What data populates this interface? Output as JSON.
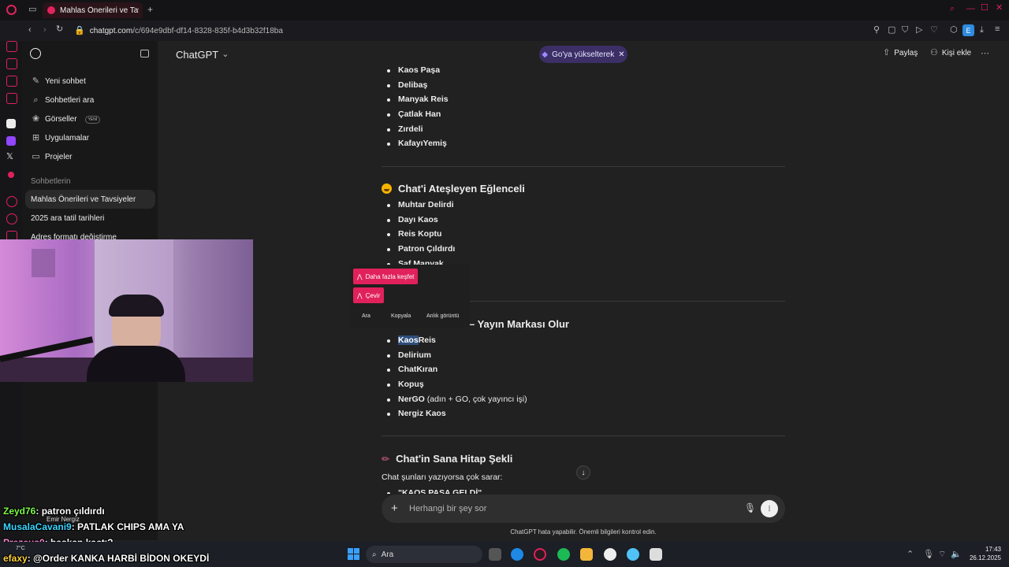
{
  "browser": {
    "tab_title": "Mahlas Önerileri ve Tavsiy",
    "url_host": "chatgpt.com",
    "url_path": "/c/694e9dbf-df14-8328-835f-b4d3b32f18ba",
    "ext_badge": "E"
  },
  "sidebar": {
    "items": [
      {
        "label": "Yeni sohbet",
        "icon": "edit-icon"
      },
      {
        "label": "Sohbetleri ara",
        "icon": "search-icon"
      },
      {
        "label": "Görseller",
        "icon": "image-icon",
        "badge": "YENİ"
      },
      {
        "label": "Uygulamalar",
        "icon": "apps-icon"
      },
      {
        "label": "Projeler",
        "icon": "folder-icon"
      }
    ],
    "section": "Sohbetlerin",
    "chats": [
      "Mahlas Önerileri ve Tavsiyeler",
      "2025 ara tatil tarihleri",
      "Adres formatı değiştirme"
    ]
  },
  "topbar": {
    "model": "ChatGPT",
    "upgrade": "Go'ya yükselterek",
    "share": "Paylaş",
    "add_person": "Kişi ekle"
  },
  "content": {
    "list1": [
      "Kaos Paşa",
      "Delibaş",
      "Manyak Reis",
      "Çatlak Han",
      "Zırdeli",
      "KafayıYemiş"
    ],
    "heading2": "Chat'i Ateşleyen Eğlenceli",
    "list2": [
      "Muhtar Delirdi",
      "Dayı Kaos",
      "Reis Koptu",
      "Patron Çıldırdı",
      "Saf Manyak"
    ],
    "heading3": "– Yayın Markası Olur",
    "list3_first_hl": "Kaos",
    "list3_first_rest": "Reis",
    "list3": [
      "Delirium",
      "ChatKıran",
      "Kopuş"
    ],
    "nergo_bold": "NerGO",
    "nergo_rest": " (adın + GO, çok yayıncı işi)",
    "list3_last": "Nergiz Kaos",
    "heading4": "Chat'in Sana Hitap Şekli",
    "paragraph": "Chat şunları yazıyorsa çok sarar:",
    "partial": "\"KAOS PAŞA GELDİ\""
  },
  "popup": {
    "discover": "Daha fazla keşfet",
    "translate": "Çevir",
    "search": "Ara",
    "copy": "Kopyala",
    "snapshot": "Anlık görüntü"
  },
  "composer": {
    "placeholder": "Herhangi bir şey sor",
    "disclaimer": "ChatGPT hata yapabilir. Önemli bilgileri kontrol edin."
  },
  "stream_chat": [
    {
      "user": "Zeyd76",
      "msg": ": patron çıldırdı"
    },
    {
      "user": "MusalaCavani9",
      "msg": ": PATLAK CHIPS AMA YA"
    },
    {
      "user": "Prezeus0",
      "msg": ": başkan kaçtı?"
    },
    {
      "user": "efaxy",
      "msg": ": @Order KANKA HARBİ BİDON OKEYDİ"
    }
  ],
  "stream_name": "Emir Nergiz",
  "taskbar": {
    "search": "Ara",
    "weather": "7°C",
    "time": "17:43",
    "date": "26.12.2025"
  },
  "colors": {
    "accent": "#e0215b",
    "bg": "#212121",
    "sidebar": "#181818"
  }
}
